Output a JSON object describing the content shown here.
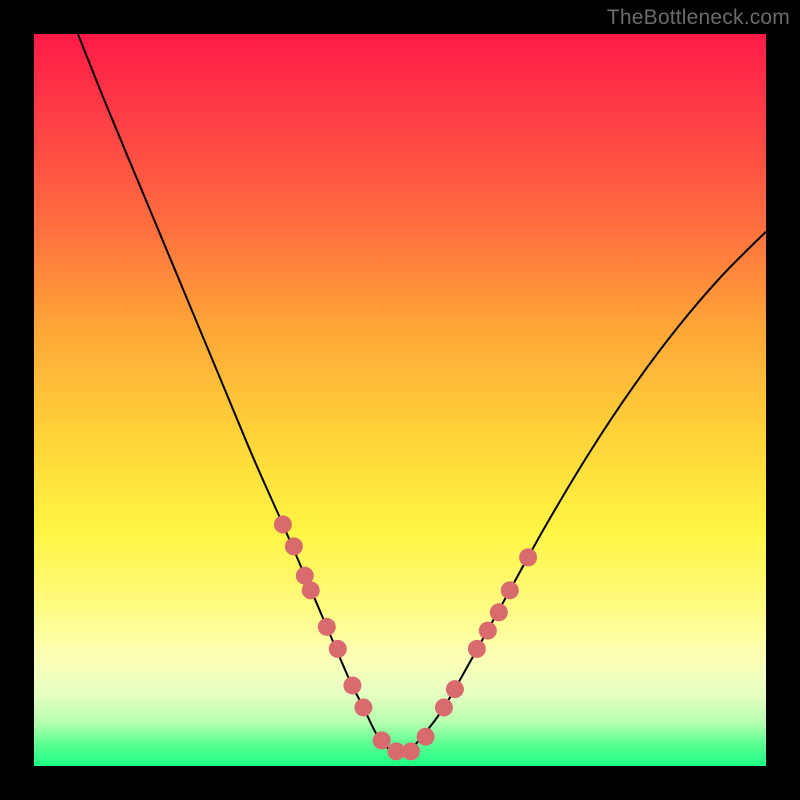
{
  "watermark": "TheBottleneck.com",
  "chart_data": {
    "type": "line",
    "title": "",
    "xlabel": "",
    "ylabel": "",
    "xlim": [
      0,
      100
    ],
    "ylim": [
      0,
      100
    ],
    "grid": false,
    "legend": false,
    "series": [
      {
        "name": "bottleneck-curve",
        "x": [
          6,
          10,
          15,
          20,
          25,
          30,
          34,
          37,
          40,
          43,
          45,
          47,
          49,
          51,
          53,
          56,
          60,
          65,
          70,
          76,
          82,
          88,
          94,
          100
        ],
        "y": [
          100,
          90,
          78,
          66,
          54,
          42,
          33,
          26,
          19,
          12,
          8,
          4,
          2,
          2,
          4,
          8,
          15,
          24,
          33,
          43,
          52,
          60,
          67,
          73
        ]
      }
    ],
    "markers": {
      "name": "highlight-dots",
      "color": "#d96a6d",
      "x": [
        34,
        35.5,
        37,
        37.8,
        40,
        41.5,
        43.5,
        45,
        47.5,
        49.5,
        51.5,
        53.5,
        56,
        57.5,
        60.5,
        62,
        63.5,
        65,
        67.5
      ],
      "y": [
        33,
        30,
        26,
        24,
        19,
        16,
        11,
        8,
        3.5,
        2,
        2,
        4,
        8,
        10.5,
        16,
        18.5,
        21,
        24,
        28.5
      ]
    }
  }
}
